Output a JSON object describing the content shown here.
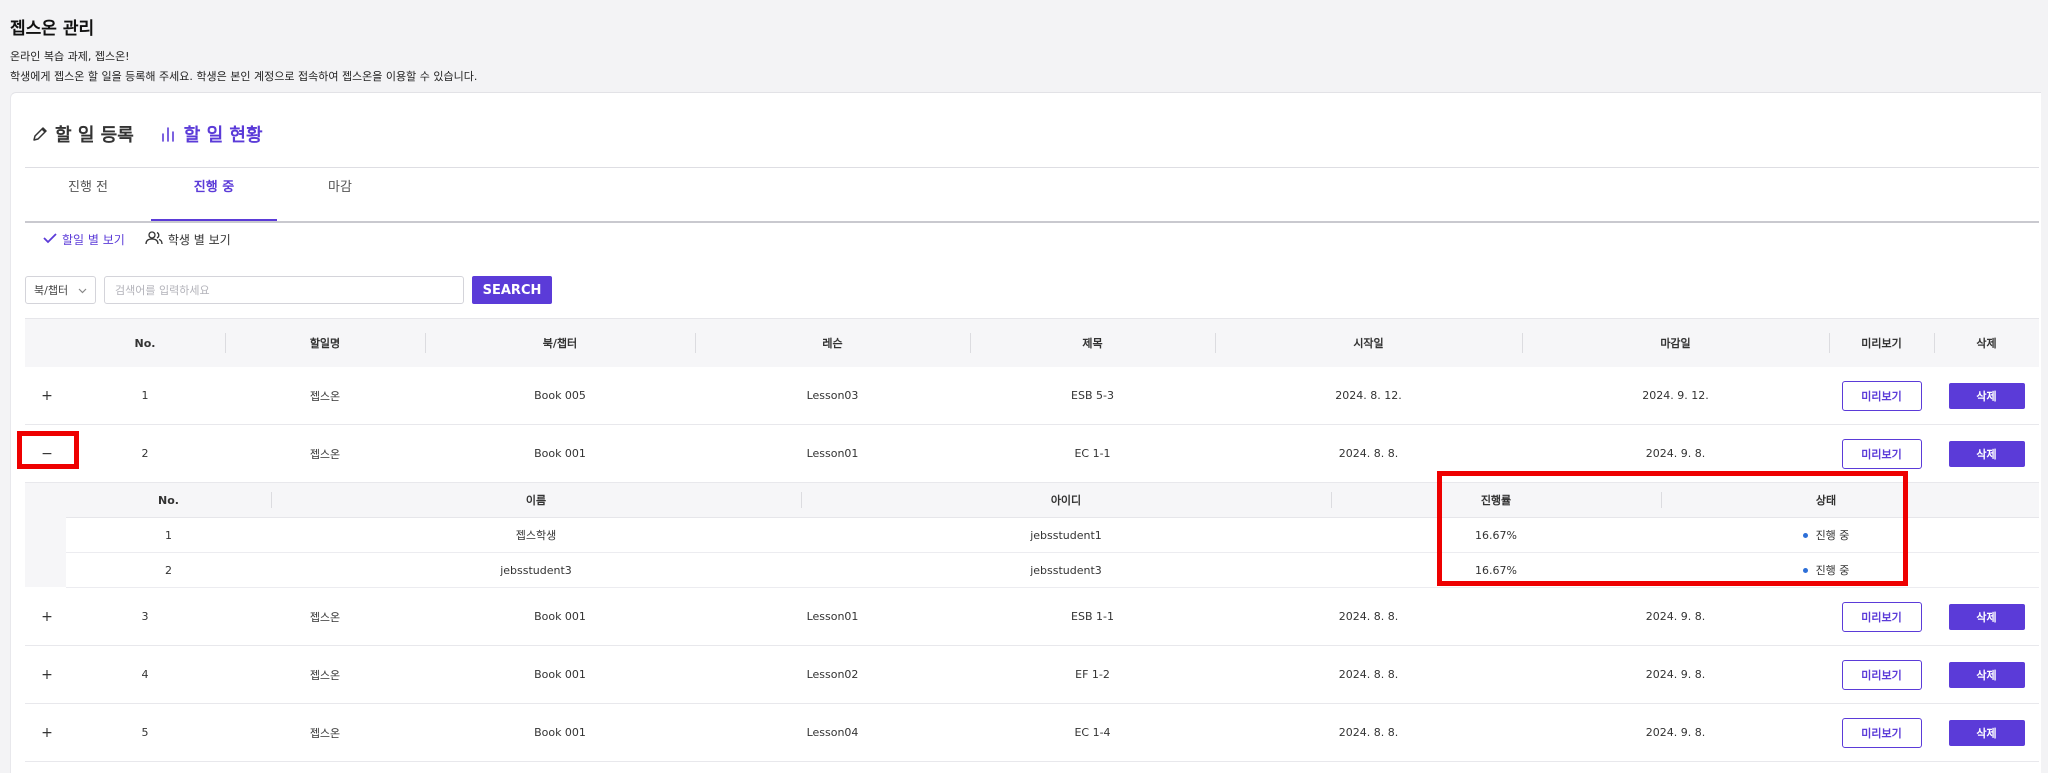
{
  "page": {
    "title": "젭스온 관리",
    "subtitle1": "온라인 복습 과제, 젭스온!",
    "subtitle2": "학생에게 젭스온 할 일을 등록해 주세요. 학생은 본인 계정으로 접속하여 젭스온을 이용할 수 있습니다."
  },
  "mode_tabs": [
    {
      "label": "할 일 등록",
      "icon": "pencil-icon",
      "active": false
    },
    {
      "label": "할 일 현황",
      "icon": "bar-chart-icon",
      "active": true
    }
  ],
  "status_tabs": [
    {
      "label": "진행 전",
      "active": false
    },
    {
      "label": "진행 중",
      "active": true
    },
    {
      "label": "마감",
      "active": false
    }
  ],
  "view_toggles": [
    {
      "label": "할일 별 보기",
      "icon": "check-icon",
      "active": true
    },
    {
      "label": "학생 별 보기",
      "icon": "users-icon",
      "active": false
    }
  ],
  "search": {
    "select_value": "북/챕터",
    "placeholder": "검색어를 입력하세요",
    "button_label": "SEARCH"
  },
  "table": {
    "headers": [
      "No.",
      "할일명",
      "북/챕터",
      "레슨",
      "제목",
      "시작일",
      "마감일",
      "미리보기",
      "삭제"
    ],
    "preview_label": "미리보기",
    "delete_label": "삭제",
    "rows": [
      {
        "toggle": "+",
        "no": "1",
        "name": "젭스온",
        "book": "Book 005",
        "lesson": "Lesson03",
        "title": "ESB 5-3",
        "start": "2024. 8. 12.",
        "end": "2024. 9. 12."
      },
      {
        "toggle": "−",
        "no": "2",
        "name": "젭스온",
        "book": "Book 001",
        "lesson": "Lesson01",
        "title": "EC 1-1",
        "start": "2024. 8. 8.",
        "end": "2024. 9. 8."
      },
      {
        "toggle": "+",
        "no": "3",
        "name": "젭스온",
        "book": "Book 001",
        "lesson": "Lesson01",
        "title": "ESB 1-1",
        "start": "2024. 8. 8.",
        "end": "2024. 9. 8."
      },
      {
        "toggle": "+",
        "no": "4",
        "name": "젭스온",
        "book": "Book 001",
        "lesson": "Lesson02",
        "title": "EF 1-2",
        "start": "2024. 8. 8.",
        "end": "2024. 9. 8."
      },
      {
        "toggle": "+",
        "no": "5",
        "name": "젭스온",
        "book": "Book 001",
        "lesson": "Lesson04",
        "title": "EC 1-4",
        "start": "2024. 8. 8.",
        "end": "2024. 9. 8."
      }
    ]
  },
  "subtable": {
    "headers": [
      "No.",
      "이름",
      "아이디",
      "진행률",
      "상태"
    ],
    "rows": [
      {
        "no": "1",
        "name": "젭스학생",
        "id": "jebsstudent1",
        "progress": "16.67%",
        "status": "진행 중"
      },
      {
        "no": "2",
        "name": "jebsstudent3",
        "id": "jebsstudent3",
        "progress": "16.67%",
        "status": "진행 중"
      }
    ]
  },
  "colors": {
    "accent": "#5b3bd8",
    "highlight": "#ee0000",
    "status_dot": "#2d6fd8"
  }
}
